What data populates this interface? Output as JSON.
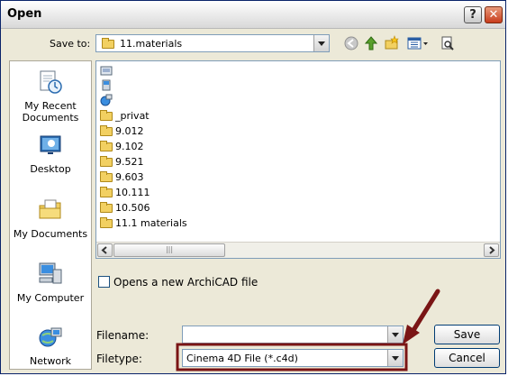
{
  "window": {
    "title": "Open",
    "help_label": "?",
    "close_label": "✕"
  },
  "save_to": {
    "label": "Save to:",
    "value": "11.materials"
  },
  "toolbar": {
    "icons": [
      "back-icon",
      "up-folder-icon",
      "new-folder-icon",
      "views-menu-icon",
      "preview-icon"
    ]
  },
  "places": [
    {
      "label": "My Recent Documents",
      "icon": "recent-documents-icon"
    },
    {
      "label": "Desktop",
      "icon": "desktop-icon"
    },
    {
      "label": "My Documents",
      "icon": "my-documents-icon"
    },
    {
      "label": "My Computer",
      "icon": "my-computer-icon"
    },
    {
      "label": "Network",
      "icon": "network-icon"
    }
  ],
  "files": [
    "_privat",
    "9.012",
    "9.102",
    "9.521",
    "9.603",
    "10.111",
    "10.506",
    "11.1 materials"
  ],
  "scrollbar": {
    "grip": "|||"
  },
  "options": {
    "opens_new_label": "Opens a new ArchiCAD file",
    "opens_new_checked": false
  },
  "filename": {
    "label": "Filename:",
    "value": ""
  },
  "filetype": {
    "label": "Filetype:",
    "value": "Cinema 4D File (*.c4d)"
  },
  "buttons": {
    "save": "Save",
    "cancel": "Cancel"
  },
  "annotation": {
    "color": "#7a1515"
  }
}
